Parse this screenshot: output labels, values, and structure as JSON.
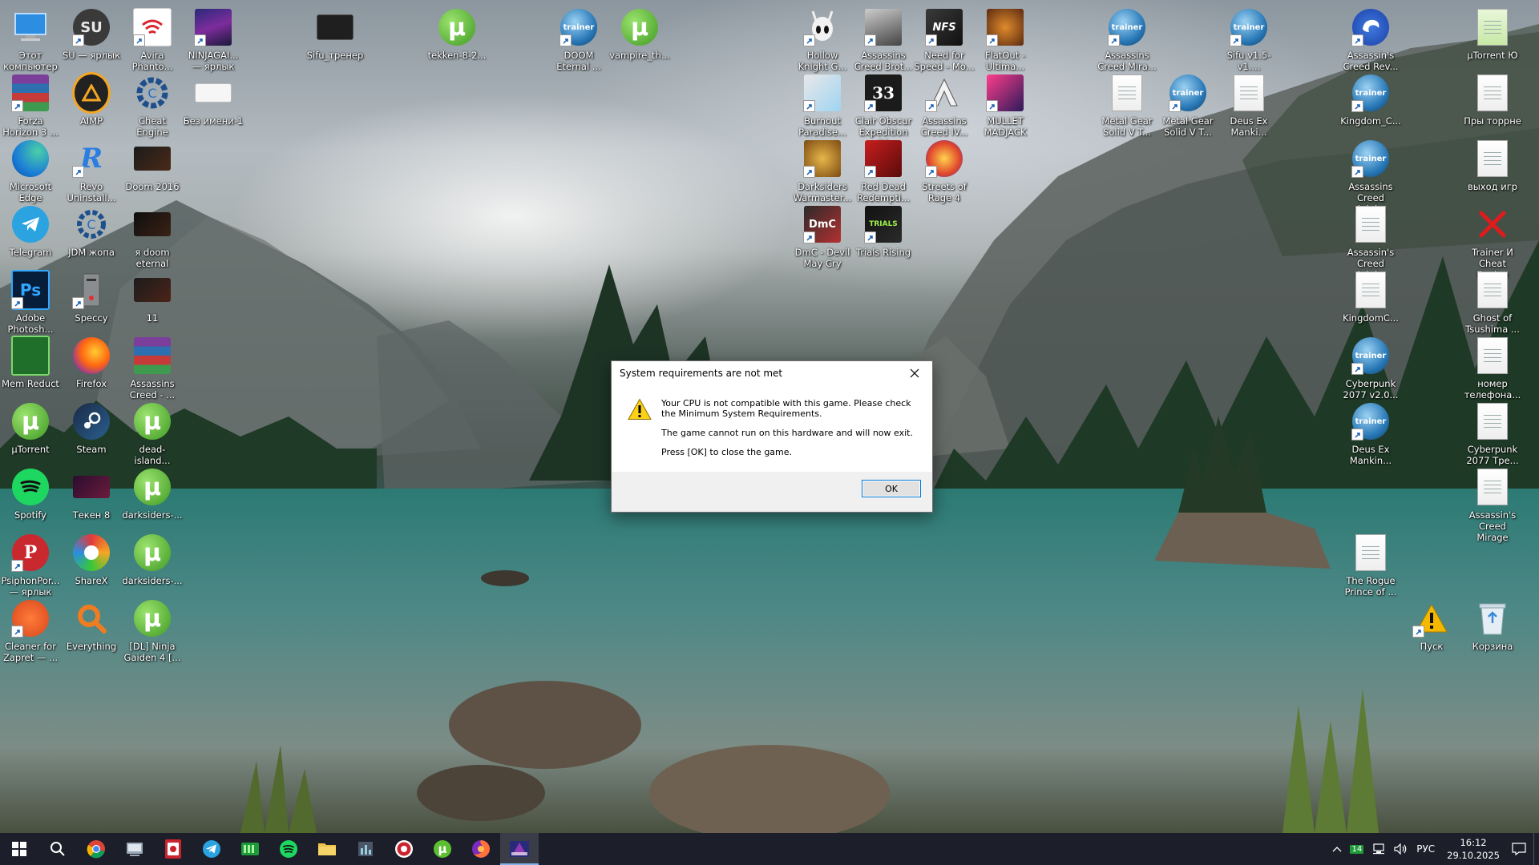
{
  "dialog": {
    "title": "System requirements are not met",
    "message_line1": "Your CPU is not compatible with this game. Please check the Minimum System Requirements.",
    "message_line2": "The game cannot run on this hardware and will now exit.",
    "message_line3": "Press [OK] to close the game.",
    "ok_label": "OK"
  },
  "desktop_icons": [
    {
      "label": "Этот компьютер"
    },
    {
      "label": "SU — ярлык",
      "glyph": "SU"
    },
    {
      "label": "Avira Phanto..."
    },
    {
      "label": "NINJAGAI... — ярлык"
    },
    {
      "label": "Sifu_тренер"
    },
    {
      "label": "tekken-8-2...",
      "glyph": "µ"
    },
    {
      "label": "DOOM Eternal ..."
    },
    {
      "label": "vampire_th...",
      "glyph": "µ"
    },
    {
      "label": "Hollow Knight G..."
    },
    {
      "label": "Assassins Creed Brot..."
    },
    {
      "label": "Need for Speed - Mo...",
      "glyph": "NFS"
    },
    {
      "label": "FlatOut - Ultima..."
    },
    {
      "label": "Assassins Creed Mira..."
    },
    {
      "label": "Sifu v1.5-v1...."
    },
    {
      "label": "Assassin's Creed Rev..."
    },
    {
      "label": "µTorrent Ю"
    },
    {
      "label": "Forza Horizon 3 ..."
    },
    {
      "label": "AIMP"
    },
    {
      "label": "Cheat Engine"
    },
    {
      "label": "Без имени-1"
    },
    {
      "label": "Burnout Paradise..."
    },
    {
      "label": "Clair Obscur Expedition 33",
      "glyph": "33"
    },
    {
      "label": "Assassins Creed IV..."
    },
    {
      "label": "MULLET MADJACK"
    },
    {
      "label": "Metal Gear Solid V T..."
    },
    {
      "label": "Metal Gear Solid V T..."
    },
    {
      "label": "Deus Ex Manki..."
    },
    {
      "label": "Kingdom_C..."
    },
    {
      "label": "Пры торрне"
    },
    {
      "label": "Microsoft Edge"
    },
    {
      "label": "Revo Uninstall..."
    },
    {
      "label": "Doom 2016"
    },
    {
      "label": "Darksiders Warmaster..."
    },
    {
      "label": "Red Dead Redempti..."
    },
    {
      "label": "Streets of Rage 4"
    },
    {
      "label": "Assassins Creed Origi..."
    },
    {
      "label": "выход игр"
    },
    {
      "label": "Telegram"
    },
    {
      "label": "JDM жопа"
    },
    {
      "label": "я doom eternal"
    },
    {
      "label": "DmC - Devil May Cry",
      "glyph": "DmC"
    },
    {
      "label": "Trials Rising",
      "glyph": "TRIALS"
    },
    {
      "label": "Assassin's Creed Origi..."
    },
    {
      "label": "Trainer И Cheat Engine"
    },
    {
      "label": "Adobe Photosh...",
      "glyph": "Ps"
    },
    {
      "label": "Speccy"
    },
    {
      "label": "11"
    },
    {
      "label": "KingdomC..."
    },
    {
      "label": "Ghost of Tsushima ..."
    },
    {
      "label": "Mem Reduct"
    },
    {
      "label": "Firefox"
    },
    {
      "label": "Assassins Creed - ..."
    },
    {
      "label": "Cyberpunk 2077 v2.0..."
    },
    {
      "label": "номер телефона..."
    },
    {
      "label": "µTorrent",
      "glyph": "µ"
    },
    {
      "label": "Steam"
    },
    {
      "label": "dead-island...",
      "glyph": "µ"
    },
    {
      "label": "Deus Ex Mankin..."
    },
    {
      "label": "Cyberpunk 2077 Тре..."
    },
    {
      "label": "Spotify"
    },
    {
      "label": "Текен 8"
    },
    {
      "label": "darksiders-...",
      "glyph": "µ"
    },
    {
      "label": "Assassin's Creed Mirage"
    },
    {
      "label": "PsiphonPor... — ярлык"
    },
    {
      "label": "ShareX"
    },
    {
      "label": "darksiders-...",
      "glyph": "µ"
    },
    {
      "label": "The Rogue Prince of ..."
    },
    {
      "label": "Cleaner for Zapret — ..."
    },
    {
      "label": "Everything"
    },
    {
      "label": "[DL] Ninja Gaiden 4 [...",
      "glyph": "µ"
    },
    {
      "label": "Пуск"
    },
    {
      "label": "Корзина"
    }
  ],
  "taskbar": {
    "icons": [
      "windows-start-icon",
      "search-icon",
      "chrome-icon",
      "file-manager-icon",
      "avira-icon",
      "telegram-icon",
      "mem-reduct-icon",
      "spotify-icon",
      "file-explorer-icon",
      "task-manager-icon",
      "uplay-icon",
      "utorrent-icon",
      "firefox-icon",
      "ninja-gaiden-icon"
    ],
    "tray": {
      "badge": "14",
      "language": "РУС",
      "time": "16:12",
      "date": "29.10.2025"
    }
  },
  "colors": {
    "taskbar_bg": "#1c1f2a",
    "accent": "#0078d7",
    "utorrent_green": "#5bbf2f"
  }
}
